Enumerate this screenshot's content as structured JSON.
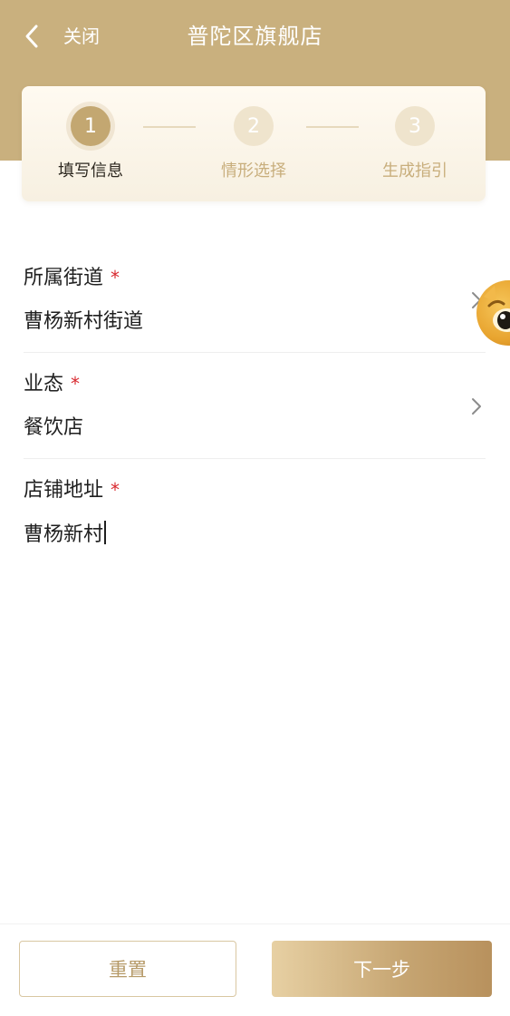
{
  "header": {
    "close_label": "关闭",
    "title": "普陀区旗舰店"
  },
  "stepper": {
    "steps": [
      {
        "number": "1",
        "label": "填写信息",
        "active": true
      },
      {
        "number": "2",
        "label": "情形选择",
        "active": false
      },
      {
        "number": "3",
        "label": "生成指引",
        "active": false
      }
    ]
  },
  "form": {
    "street": {
      "label": "所属街道",
      "required_mark": "*",
      "value": "曹杨新村街道"
    },
    "business_type": {
      "label": "业态",
      "required_mark": "*",
      "value": "餐饮店"
    },
    "address": {
      "label": "店铺地址",
      "required_mark": "*",
      "value": "曹杨新村"
    }
  },
  "footer": {
    "reset_label": "重置",
    "next_label": "下一步"
  },
  "colors": {
    "brand_gold": "#c9b07e",
    "required_red": "#d8292f"
  },
  "icons": {
    "back": "chevron-left-icon",
    "row_arrow": "chevron-right-icon",
    "assistant": "mascot-avatar"
  }
}
